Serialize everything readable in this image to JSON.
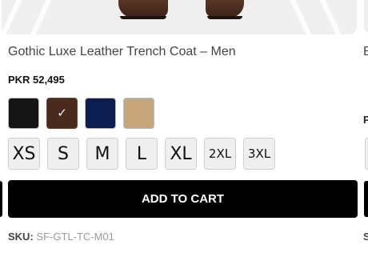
{
  "product": {
    "title": "Gothic Luxe Leather Trench Coat – Men",
    "price": "PKR 52,495",
    "sku_label": "SKU:",
    "sku_value": "SF-GTL-TC-M01",
    "add_to_cart_label": "ADD TO CART"
  },
  "colors": [
    {
      "name": "black",
      "hex": "#151515",
      "selected": false
    },
    {
      "name": "brown",
      "hex": "#4a2a1c",
      "selected": true
    },
    {
      "name": "navy",
      "hex": "#0c1d52",
      "selected": false
    },
    {
      "name": "tan",
      "hex": "#c9a57c",
      "selected": false
    }
  ],
  "sizes": [
    "XS",
    "S",
    "M",
    "L",
    "XL",
    "2XL",
    "3XL"
  ],
  "next_card": {
    "title_initial": "B",
    "price_initial": "P",
    "sku_initial": "S"
  },
  "icons": {
    "selected_check": "✓"
  }
}
